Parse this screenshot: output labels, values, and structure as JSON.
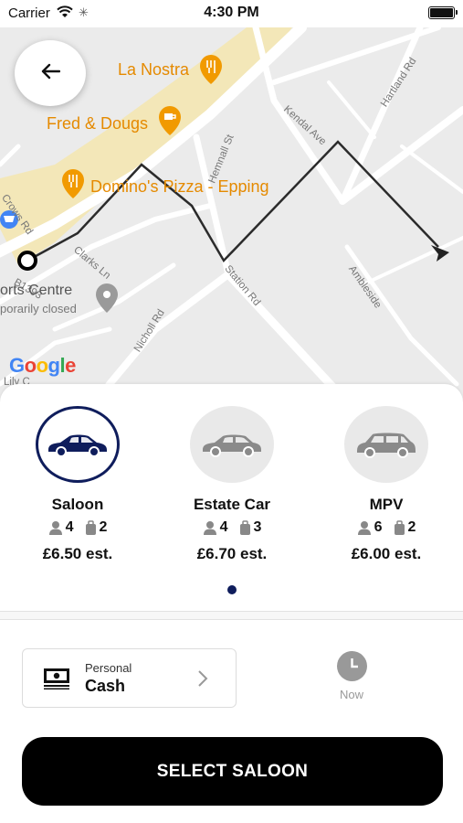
{
  "status_bar": {
    "carrier": "Carrier",
    "time": "4:30 PM"
  },
  "map": {
    "places": [
      {
        "name": "La Nostra",
        "icon": "restaurant-icon"
      },
      {
        "name": "Fred & Dougs",
        "icon": "cafe-icon"
      },
      {
        "name": "Domino's Pizza - Epping",
        "icon": "restaurant-icon"
      }
    ],
    "streets": [
      "Hartland Rd",
      "Kendal Ave",
      "Hemnall St",
      "Crows Rd",
      "Clarks Ln",
      "Station Rd",
      "Nicholl Rd",
      "Ambleside",
      "B1393"
    ],
    "sports_centre": {
      "name": "orts Centre",
      "status": "porarily closed"
    },
    "fragment": "Lily C",
    "attribution": "Google",
    "route_color": "#2b2b2b"
  },
  "vehicles": [
    {
      "name": "Saloon",
      "passengers": "4",
      "luggage": "2",
      "price": "£6.50 est.",
      "selected": true
    },
    {
      "name": "Estate Car",
      "passengers": "4",
      "luggage": "3",
      "price": "£6.70 est.",
      "selected": false
    },
    {
      "name": "MPV",
      "passengers": "6",
      "luggage": "2",
      "price": "£6.00 est.",
      "selected": false
    }
  ],
  "payment": {
    "type": "Personal",
    "method": "Cash"
  },
  "pickup_time": {
    "label": "Now"
  },
  "action": {
    "label": "SELECT SALOON"
  },
  "colors": {
    "accent": "#0f1d5c",
    "poi": "#e58a00",
    "button": "#000000"
  }
}
